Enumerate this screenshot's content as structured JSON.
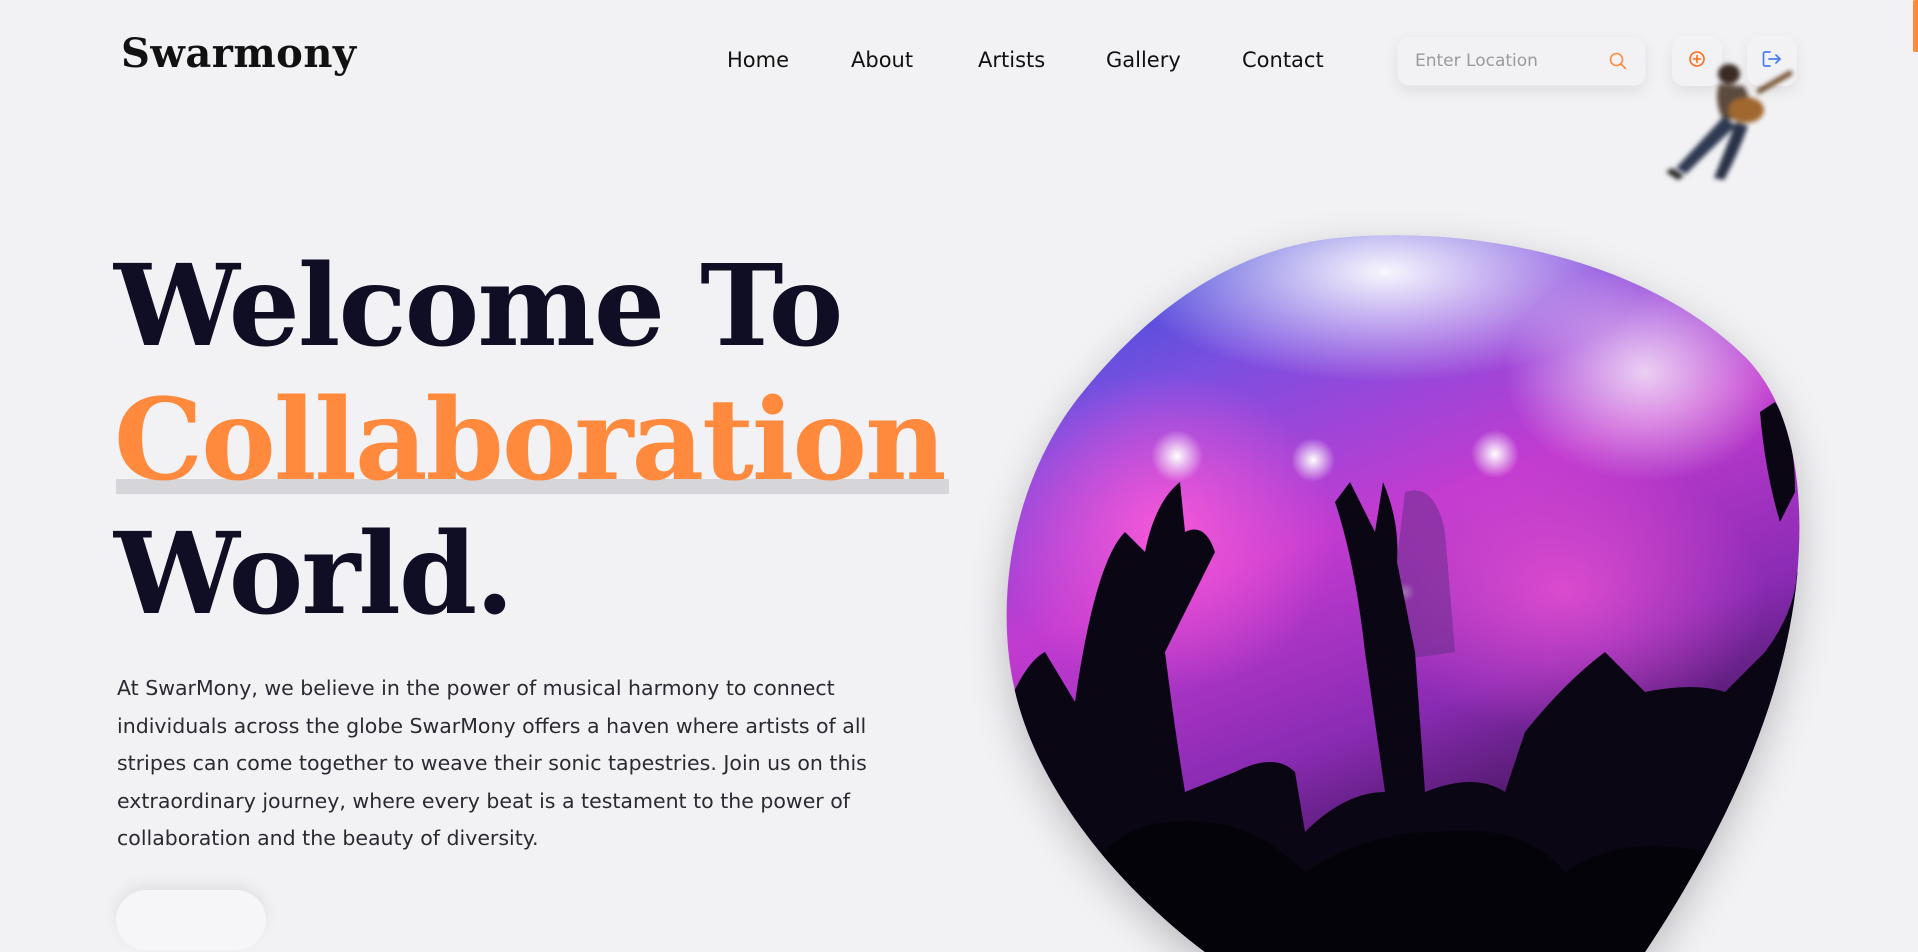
{
  "brand": {
    "name": "Swarmony"
  },
  "nav": {
    "items": [
      {
        "label": "Home"
      },
      {
        "label": "About"
      },
      {
        "label": "Artists"
      },
      {
        "label": "Gallery"
      },
      {
        "label": "Contact"
      }
    ]
  },
  "search": {
    "placeholder": "Enter Location",
    "value": "",
    "icon": "search-icon"
  },
  "actions": {
    "add_icon": "plus-circle-icon",
    "logout_icon": "logout-icon"
  },
  "hero": {
    "title_line1": "Welcome To",
    "title_accent": "Collaboration",
    "title_line3": "World.",
    "description": "At SwarMony, we believe in the power of musical harmony to connect individuals across the globe SwarMony offers a haven where artists of all stripes can come together to weave their sonic tapestries. Join us on this extraordinary journey, where every beat is a testament to the power of collaboration and the beauty of diversity."
  },
  "colors": {
    "accent": "#ff8a3d",
    "title": "#0f0e24",
    "background": "#f2f2f4",
    "logout_icon": "#4a7bf7"
  }
}
